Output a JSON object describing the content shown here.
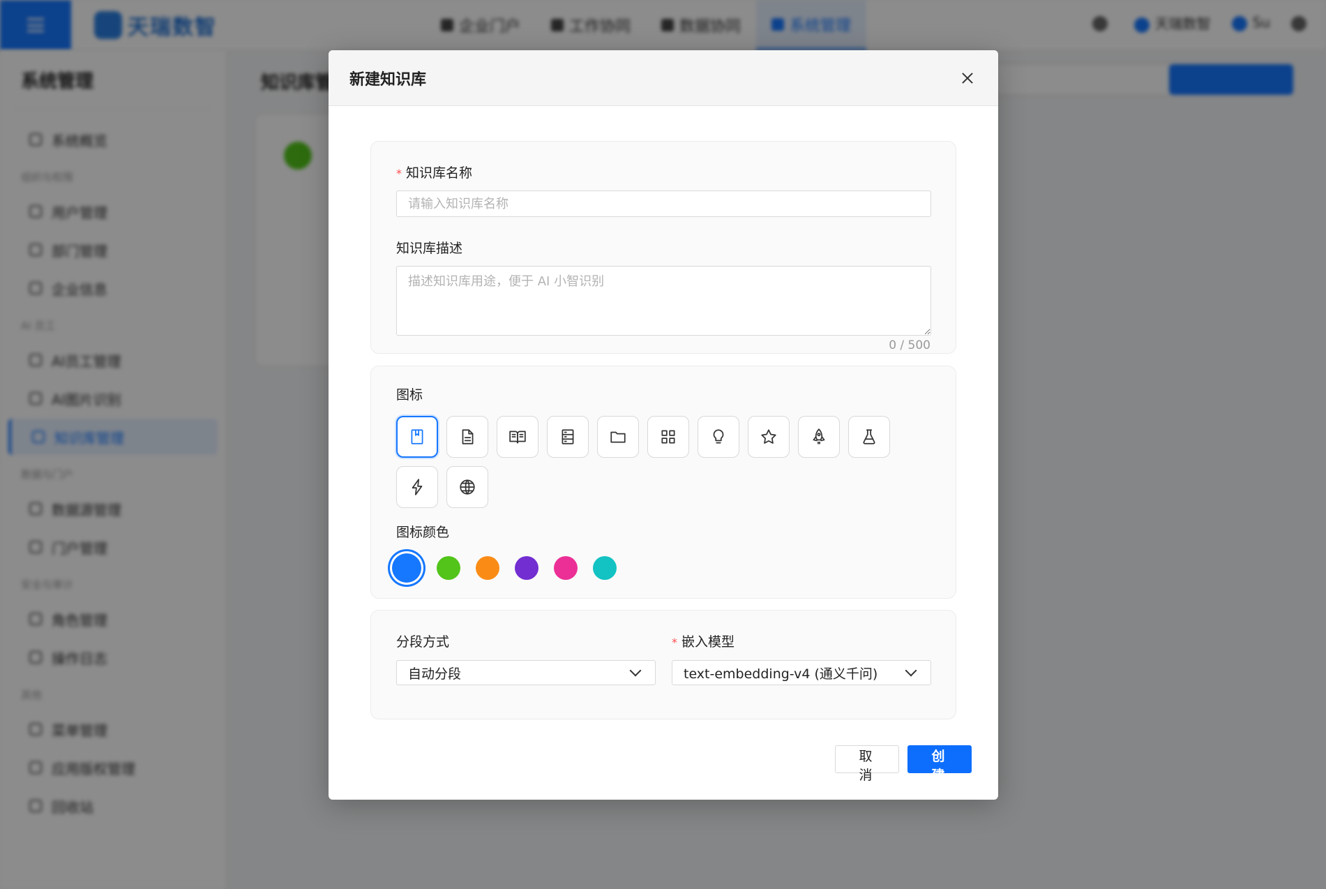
{
  "background": {
    "brand": "天瑞数智",
    "top_nav": [
      "企业门户",
      "工作协同",
      "数据协同",
      "系统管理"
    ],
    "top_right": {
      "company": "天瑞数智",
      "user": "Su"
    },
    "sidebar_title": "系统管理",
    "sidebar_items": [
      "系统概览",
      "用户管理",
      "部门管理",
      "企业信息",
      "AI员工管理",
      "AI图片识别",
      "知识库管理",
      "数据源管理",
      "门户管理",
      "角色管理",
      "操作日志",
      "菜单管理",
      "应用版权管理",
      "回收站"
    ],
    "sidebar_groups": [
      "组织与权限",
      "AI 员工",
      "数据与门户",
      "安全与审计",
      "其他"
    ],
    "page_title": "知识库管理"
  },
  "modal": {
    "title": "新建知识库",
    "name_label": "知识库名称",
    "name_placeholder": "请输入知识库名称",
    "desc_label": "知识库描述",
    "desc_placeholder": "描述知识库用途，便于 AI 小智识别",
    "desc_counter": "0 / 500",
    "icon_label": "图标",
    "icons": [
      "bookmark-icon",
      "file-text-icon",
      "book-open-icon",
      "server-icon",
      "folder-icon",
      "grid-icon",
      "bulb-icon",
      "star-icon",
      "rocket-icon",
      "flask-icon",
      "bolt-icon",
      "globe-icon"
    ],
    "selected_icon": "bookmark-icon",
    "color_label": "图标颜色",
    "colors": [
      "#1677ff",
      "#52c41a",
      "#fa8c16",
      "#722ed1",
      "#eb2f96",
      "#13c2c2"
    ],
    "selected_color": "#1677ff",
    "split_label": "分段方式",
    "split_value": "自动分段",
    "model_label": "嵌入模型",
    "model_value": "text-embedding-v4 (通义千问)",
    "cancel_label": "取 消",
    "create_label": "创 建"
  },
  "theme": {
    "primary": "#1677ff",
    "required": "#ff4d4f"
  }
}
